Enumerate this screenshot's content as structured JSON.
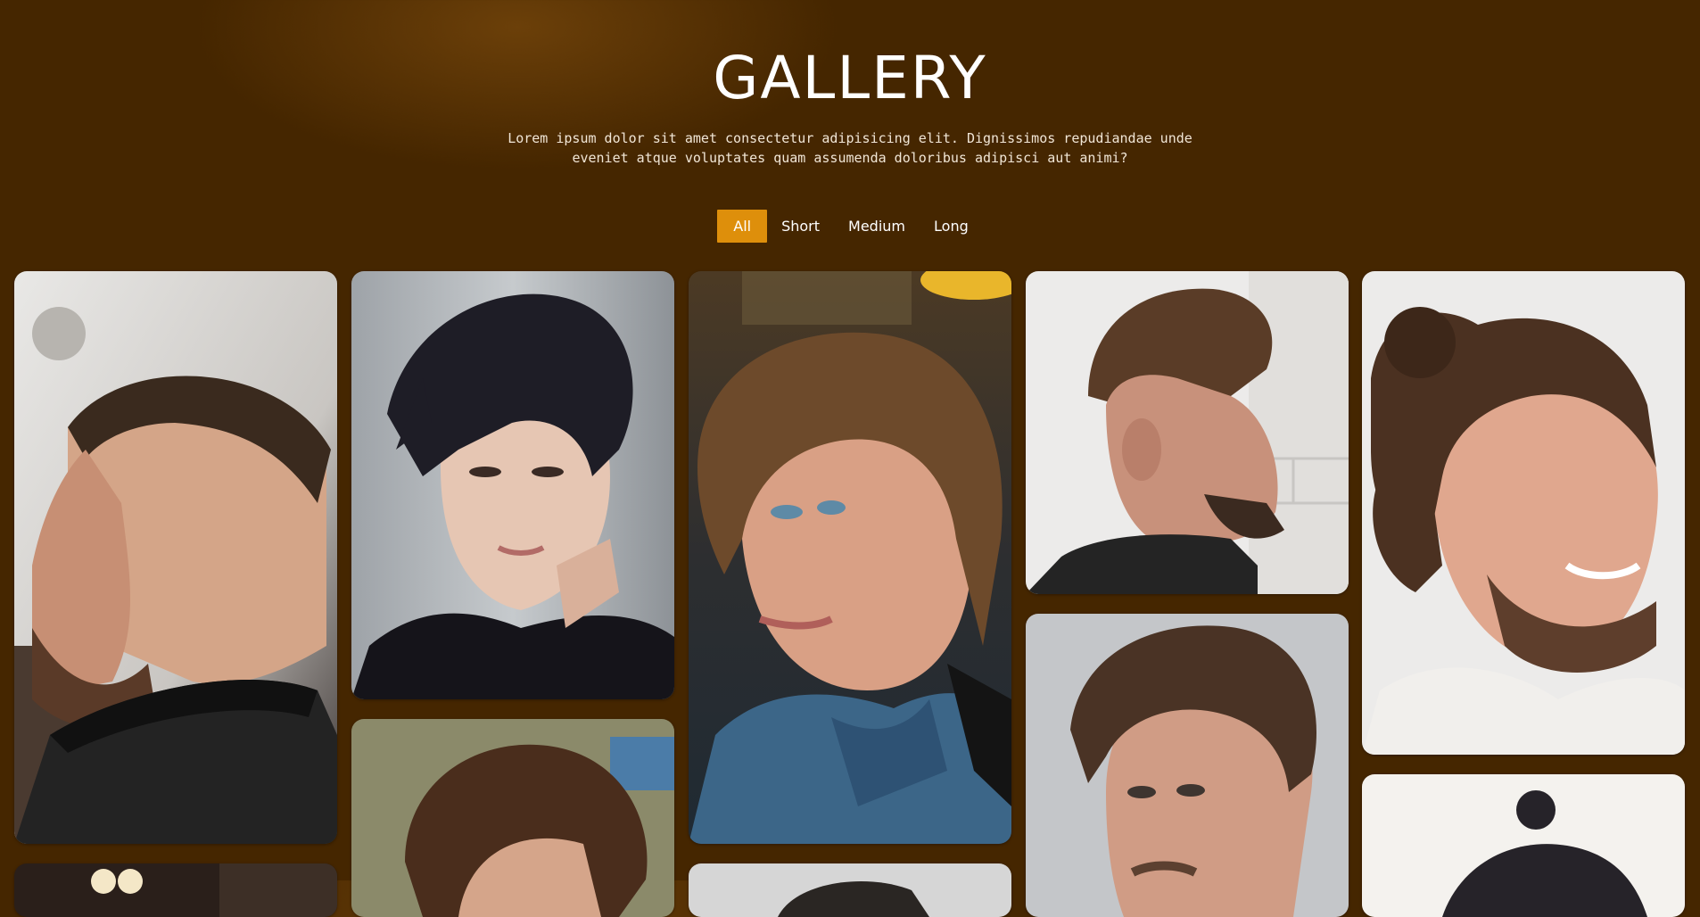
{
  "header": {
    "title": "GALLERY",
    "subtitle": "Lorem ipsum dolor sit amet consectetur adipisicing elit. Dignissimos repudiandae unde eveniet atque voluptates quam assumenda doloribus adipisci aut animi?"
  },
  "filters": [
    "All",
    "Short",
    "Medium",
    "Long"
  ],
  "active_filter": "All",
  "colors": {
    "background": "#452600",
    "accent": "#de8f0b",
    "text": "#ffffff"
  }
}
